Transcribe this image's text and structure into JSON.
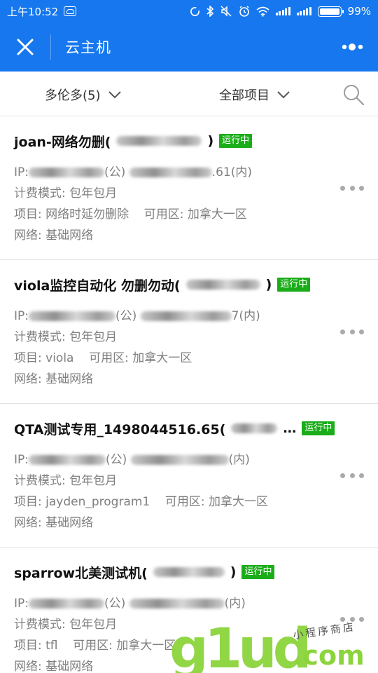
{
  "status_bar": {
    "time": "上午10:52",
    "battery": "99%",
    "icons": [
      "cloud-badge-icon",
      "sync-icon",
      "bluetooth-icon",
      "mute-icon",
      "alarm-icon",
      "wifi-icon",
      "signal-icon",
      "signal-icon",
      "battery-icon"
    ]
  },
  "header": {
    "title": "云主机",
    "close_icon": "close-icon",
    "more_icon": "more-dots-icon"
  },
  "filters": {
    "region": "多伦多(5)",
    "project": "全部项目",
    "search_icon": "search-icon"
  },
  "instances": [
    {
      "name": "joan-网络勿删(",
      "name_suffix": ")",
      "status": "运行中",
      "ip_label": "IP:",
      "public_tag": "(公)",
      "private_tail": ".61(内)",
      "billing": "计费模式: 包年包月",
      "project": "项目: 网络时延勿删除",
      "zone": "可用区: 加拿大一区",
      "network": "网络: 基础网络"
    },
    {
      "name": "viola监控自动化 勿删勿动(",
      "name_suffix": ")",
      "status": "运行中",
      "ip_label": "IP:",
      "public_tag": "(公)",
      "private_tail": "7(内)",
      "billing": "计费模式: 包年包月",
      "project": "项目: viola",
      "zone": "可用区: 加拿大一区",
      "network": "网络: 基础网络"
    },
    {
      "name": "QTA测试专用_1498044516.65(",
      "name_suffix": "…",
      "status": "运行中",
      "ip_label": "IP:",
      "public_tag": "(公)",
      "private_tail": "(内)",
      "billing": "计费模式: 包年包月",
      "project": "项目: jayden_program1",
      "zone": "可用区: 加拿大一区",
      "network": "网络: 基础网络"
    },
    {
      "name": "sparrow北美测试机(",
      "name_suffix": ")",
      "status": "运行中",
      "ip_label": "IP:",
      "public_tag": "(公)",
      "private_tail": "(内)",
      "billing": "计费模式: 包年包月",
      "project": "项目: tfl",
      "zone": "可用区: 加拿大一区",
      "network": "网络: 基础网络"
    }
  ],
  "watermark": {
    "brand": "g1ud",
    "domain": ".com",
    "caption": "小程序商店"
  },
  "colors": {
    "primary": "#1677ee",
    "running_badge": "#1aad19",
    "watermark": "#8cd43c"
  }
}
